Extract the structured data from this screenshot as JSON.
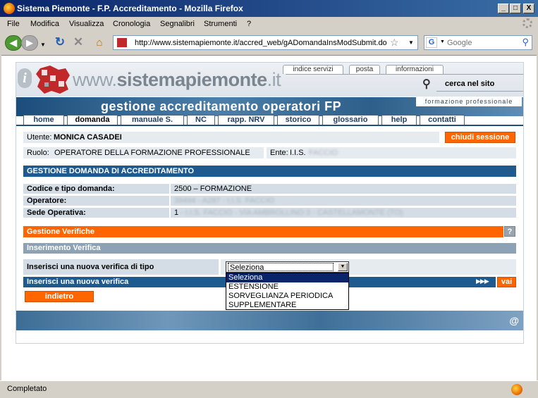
{
  "window": {
    "title": "Sistema Piemonte - F.P. Accreditamento - Mozilla Firefox",
    "minimize": "_",
    "maximize": "□",
    "close": "X"
  },
  "menu": [
    "File",
    "Modifica",
    "Visualizza",
    "Cronologia",
    "Segnalibri",
    "Strumenti",
    "?"
  ],
  "navigation": {
    "url": "http://www.sistemapiemonte.it/accred_web/gADomandaInsModSubmit.do",
    "search_placeholder": "Google"
  },
  "site": {
    "logo_text_prefix": "www.",
    "logo_text_brand": "sistemapiemonte",
    "logo_text_suffix": ".it",
    "top_links": [
      "indice servizi",
      "posta",
      "informazioni"
    ],
    "search_site": "cerca nel sito",
    "banner_title": "gestione accreditamento operatori FP",
    "banner_tag": "formazione professionale",
    "tabs": [
      "home",
      "domanda",
      "manuale S.",
      "NC",
      "rapp. NRV",
      "storico",
      "glossario",
      "help",
      "contatti"
    ],
    "active_tab": "domanda"
  },
  "user": {
    "user_label": "Utente:",
    "user_name": "MONICA CASADEI",
    "logout": "chiudi sessione",
    "role_label": "Ruolo:",
    "role_value": "OPERATORE DELLA FORMAZIONE PROFESSIONALE",
    "ente_label": "Ente:",
    "ente_value": "I.I.S.",
    "ente_value_hidden": "FACCIO"
  },
  "section_domanda": {
    "title": "GESTIONE DOMANDA DI ACCREDITAMENTO",
    "rows": [
      {
        "label": "Codice e tipo domanda:",
        "value": "2500 – FORMAZIONE",
        "hidden": ""
      },
      {
        "label": "Operatore:",
        "value": "",
        "hidden": "39494 - A287 - I.I.S. FACCIO"
      },
      {
        "label": "Sede Operativa:",
        "value": "1",
        "hidden": "- I.I.S. FACCIO - VIA AMBROLLINO 3 - CASTELLAMONTE (TO)"
      }
    ]
  },
  "verifiche": {
    "title": "Gestione Verifiche",
    "help": "?",
    "sub_title": "Inserimento Verifica",
    "prompt": "Inserisci una nuova verifica di tipo",
    "select_value": "Seleziona",
    "options": [
      "Seleziona",
      "ESTENSIONE",
      "SORVEGLIANZA PERIODICA",
      "SUPPLEMENTARE"
    ],
    "action_bar": "Inserisci una nuova verifica",
    "arrows": "▶▶▶",
    "go": "vai",
    "back": "indietro"
  },
  "footer": {
    "at": "@"
  },
  "status": {
    "text": "Completato"
  }
}
